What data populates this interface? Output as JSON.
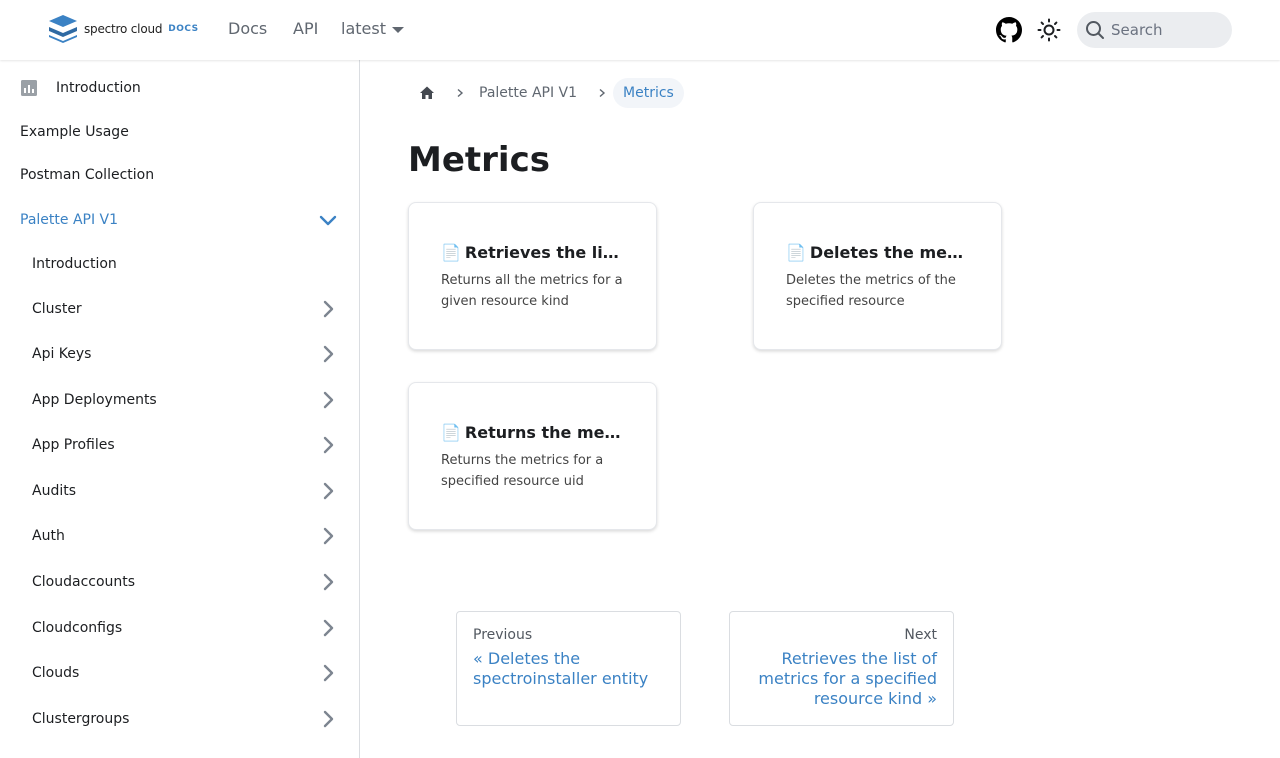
{
  "header": {
    "logo_text": "spectro cloud",
    "logo_docs": "DOCS",
    "nav": [
      {
        "label": "Docs"
      },
      {
        "label": "API"
      }
    ],
    "version_label": "latest",
    "search_placeholder": "Search"
  },
  "sidebar": {
    "items": [
      {
        "label": "Introduction"
      },
      {
        "label": "Example Usage"
      },
      {
        "label": "Postman Collection"
      },
      {
        "label": "Palette API V1"
      },
      {
        "label": "Introduction"
      },
      {
        "label": "Cluster"
      },
      {
        "label": "Api Keys"
      },
      {
        "label": "App Deployments"
      },
      {
        "label": "App Profiles"
      },
      {
        "label": "Audits"
      },
      {
        "label": "Auth"
      },
      {
        "label": "Cloudaccounts"
      },
      {
        "label": "Cloudconfigs"
      },
      {
        "label": "Clouds"
      },
      {
        "label": "Clustergroups"
      }
    ]
  },
  "breadcrumb": {
    "parent": "Palette API V1",
    "current": "Metrics"
  },
  "page": {
    "title": "Metrics"
  },
  "cards": [
    {
      "icon": "📄",
      "title": "Retrieves the list of metrics for a specified resource kind",
      "desc": "Returns all the metrics for a given resource kind"
    },
    {
      "icon": "📄",
      "title": "Deletes the metrics of the specified resource",
      "desc": "Deletes the metrics of the specified resource"
    },
    {
      "icon": "📄",
      "title": "Returns the metrics for a specified resource uid",
      "desc": "Returns the metrics for a specified resource uid"
    }
  ],
  "pagination": {
    "prev_sub": "Previous",
    "prev_label": "« Deletes the spectroinstaller entity",
    "next_sub": "Next",
    "next_label": "Retrieves the list of metrics for a specified resource kind »"
  },
  "colors": {
    "accent": "#3b82c4",
    "text": "#1c1e21",
    "muted": "#606770"
  }
}
